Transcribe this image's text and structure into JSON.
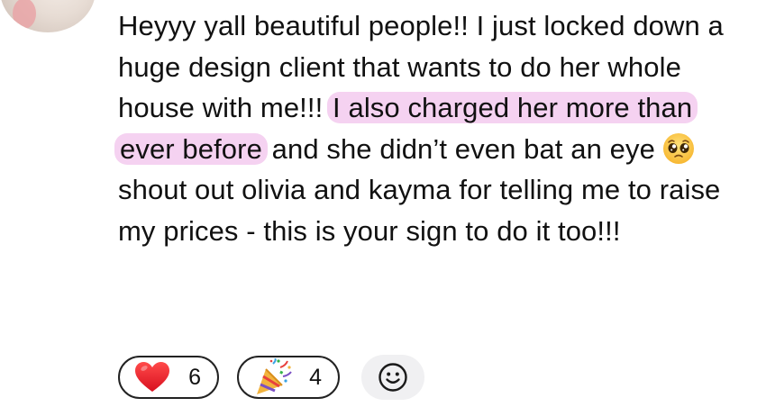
{
  "post": {
    "text_before_highlight": "Heyyy yall beautiful people!! I just locked down a huge design client that wants to do her whole house with me!!! ",
    "highlighted_text": "I also charged her more than ever before",
    "text_before_emoji": " and she didn’t even bat an eye",
    "emoji": "pleading-face-icon",
    "text_after_emoji": "shout out olivia and kayma for telling me to raise my prices - this is your sign to do it too!!!",
    "highlight_color": "#f5d2f1"
  },
  "reactions": [
    {
      "icon": "heart-icon",
      "count": "6",
      "color": "#e21b2d"
    },
    {
      "icon": "party-popper-icon",
      "count": "4"
    }
  ],
  "add_reaction": {
    "icon": "smiley-icon"
  }
}
